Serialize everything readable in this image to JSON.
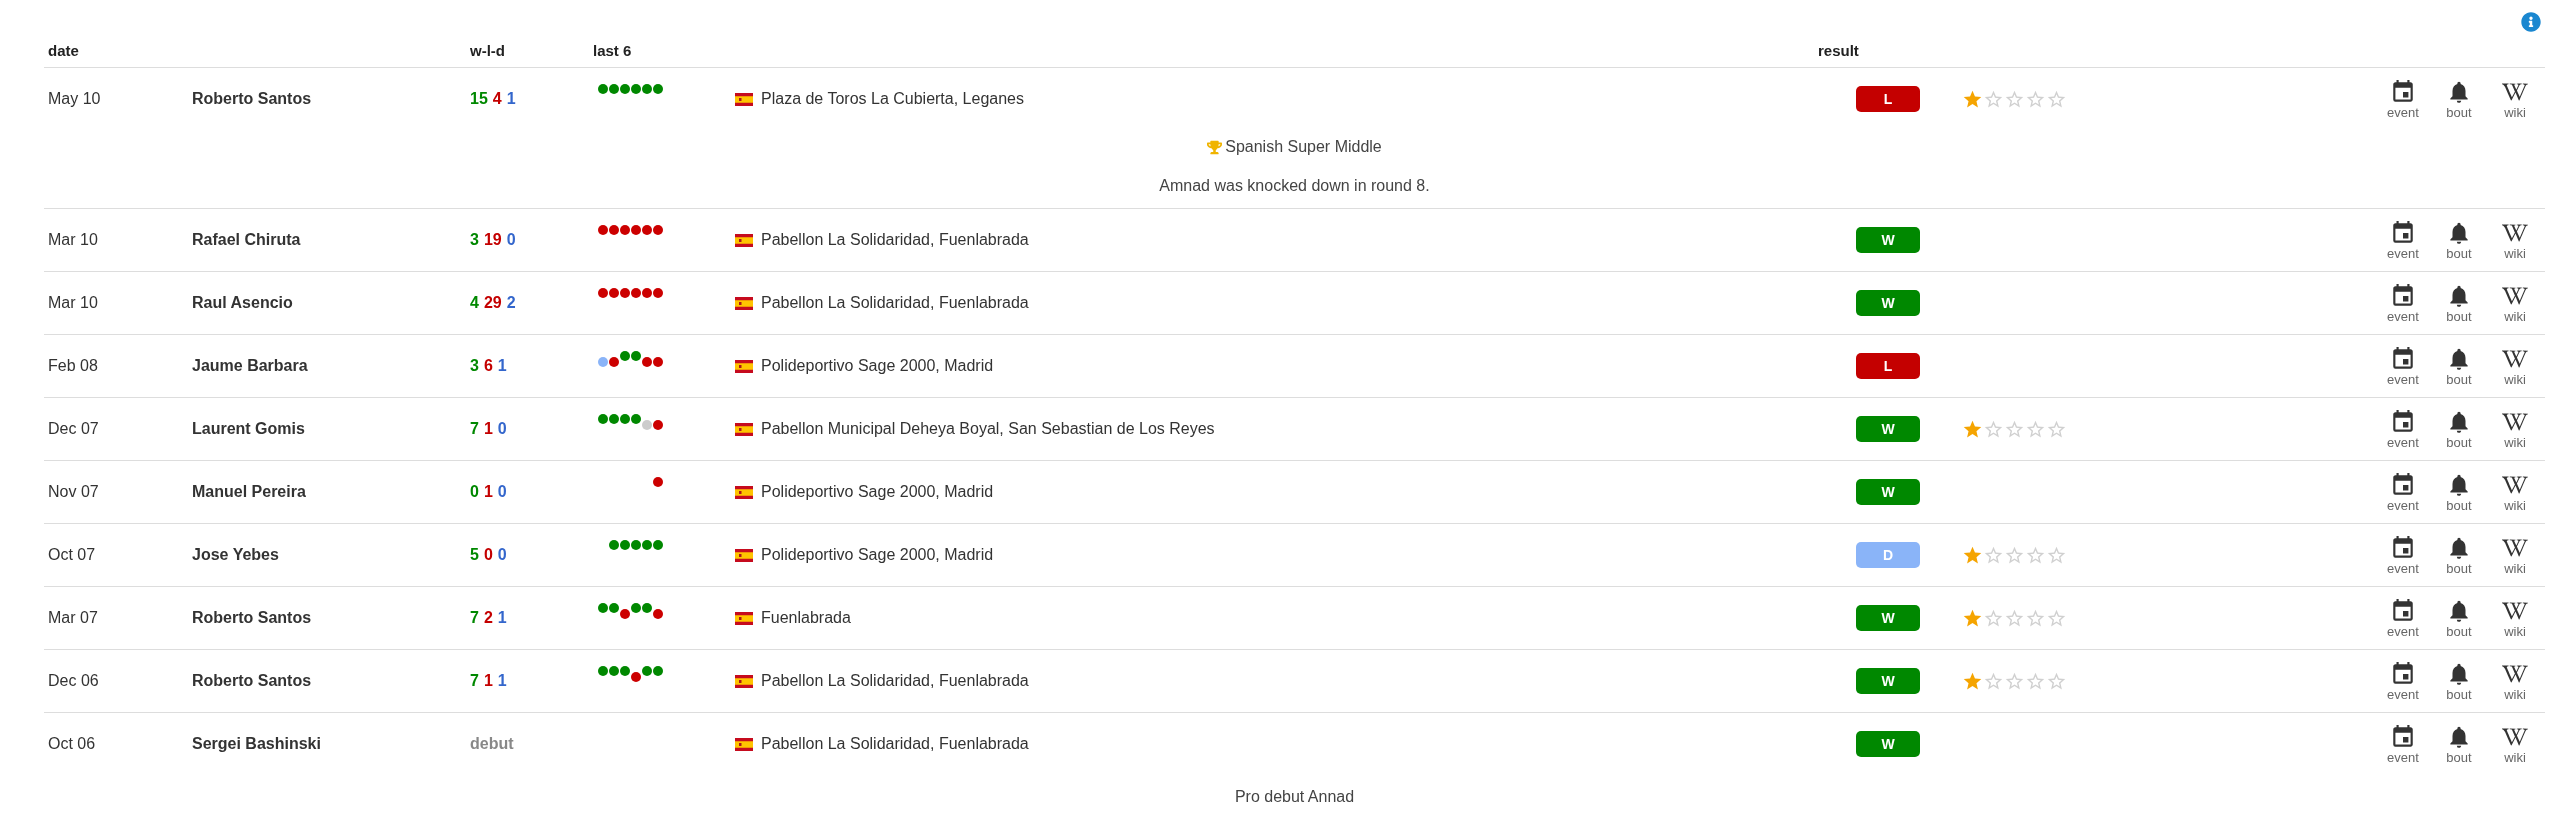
{
  "header": {
    "date": "date",
    "record": "w-l-d",
    "last_6": "last 6",
    "result": "result"
  },
  "rows": [
    {
      "date": "May 10",
      "opponent": "Roberto Santos",
      "record": {
        "kind": "counts",
        "w": "15",
        "l": "4",
        "d": "1"
      },
      "last_6": [
        {
          "kind": "win",
          "raised": true
        },
        {
          "kind": "win",
          "raised": true
        },
        {
          "kind": "win",
          "raised": true
        },
        {
          "kind": "win",
          "raised": true
        },
        {
          "kind": "win",
          "raised": true
        },
        {
          "kind": "win",
          "raised": true
        }
      ],
      "venue": "Plaza de Toros La Cubierta, Leganes",
      "result": {
        "kind": "loss",
        "label": "L"
      },
      "stars": 1,
      "links": [
        {
          "kind": "event",
          "label": "event"
        },
        {
          "kind": "bout",
          "label": "bout"
        },
        {
          "kind": "wiki",
          "label": "wiki"
        }
      ],
      "notes": [
        {
          "kind": "title",
          "text": "Spanish Super Middle"
        },
        {
          "kind": "text",
          "text": "Amnad was knocked down in round 8."
        }
      ]
    },
    {
      "date": "Mar 10",
      "opponent": "Rafael Chiruta",
      "record": {
        "kind": "counts",
        "w": "3",
        "l": "19",
        "d": "0"
      },
      "last_6": [
        {
          "kind": "loss",
          "raised": true
        },
        {
          "kind": "loss",
          "raised": true
        },
        {
          "kind": "loss",
          "raised": true
        },
        {
          "kind": "loss",
          "raised": true
        },
        {
          "kind": "loss",
          "raised": true
        },
        {
          "kind": "loss",
          "raised": true
        }
      ],
      "venue": "Pabellon La Solidaridad, Fuenlabrada",
      "result": {
        "kind": "win",
        "label": "W"
      },
      "links": [
        {
          "kind": "event",
          "label": "event"
        },
        {
          "kind": "bout",
          "label": "bout"
        },
        {
          "kind": "wiki",
          "label": "wiki"
        }
      ]
    },
    {
      "date": "Mar 10",
      "opponent": "Raul Asencio",
      "record": {
        "kind": "counts",
        "w": "4",
        "l": "29",
        "d": "2"
      },
      "last_6": [
        {
          "kind": "loss",
          "raised": true
        },
        {
          "kind": "loss",
          "raised": true
        },
        {
          "kind": "loss",
          "raised": true
        },
        {
          "kind": "loss",
          "raised": true
        },
        {
          "kind": "loss",
          "raised": true
        },
        {
          "kind": "loss",
          "raised": true
        }
      ],
      "venue": "Pabellon La Solidaridad, Fuenlabrada",
      "result": {
        "kind": "win",
        "label": "W"
      },
      "links": [
        {
          "kind": "event",
          "label": "event"
        },
        {
          "kind": "bout",
          "label": "bout"
        },
        {
          "kind": "wiki",
          "label": "wiki"
        }
      ]
    },
    {
      "date": "Feb 08",
      "opponent": "Jaume Barbara",
      "record": {
        "kind": "counts",
        "w": "3",
        "l": "6",
        "d": "1"
      },
      "last_6": [
        {
          "kind": "draw",
          "raised": false
        },
        {
          "kind": "loss",
          "raised": false
        },
        {
          "kind": "win",
          "raised": true
        },
        {
          "kind": "win",
          "raised": true
        },
        {
          "kind": "loss",
          "raised": false
        },
        {
          "kind": "loss",
          "raised": false
        }
      ],
      "venue": "Polideportivo Sage 2000, Madrid",
      "result": {
        "kind": "loss",
        "label": "L"
      },
      "links": [
        {
          "kind": "event",
          "label": "event"
        },
        {
          "kind": "bout",
          "label": "bout"
        },
        {
          "kind": "wiki",
          "label": "wiki"
        }
      ]
    },
    {
      "date": "Dec 07",
      "opponent": "Laurent Gomis",
      "record": {
        "kind": "counts",
        "w": "7",
        "l": "1",
        "d": "0"
      },
      "last_6": [
        {
          "kind": "win",
          "raised": true
        },
        {
          "kind": "win",
          "raised": true
        },
        {
          "kind": "win",
          "raised": true
        },
        {
          "kind": "win",
          "raised": true
        },
        {
          "kind": "nc",
          "raised": false
        },
        {
          "kind": "loss",
          "raised": false
        }
      ],
      "venue": "Pabellon Municipal Deheya Boyal, San Sebastian de Los Reyes",
      "result": {
        "kind": "win",
        "label": "W"
      },
      "stars": 1,
      "links": [
        {
          "kind": "event",
          "label": "event"
        },
        {
          "kind": "bout",
          "label": "bout"
        },
        {
          "kind": "wiki",
          "label": "wiki"
        }
      ]
    },
    {
      "date": "Nov 07",
      "opponent": "Manuel Pereira",
      "record": {
        "kind": "counts",
        "w": "0",
        "l": "1",
        "d": "0"
      },
      "last_6": [
        {
          "kind": "loss",
          "raised": true
        }
      ],
      "venue": "Polideportivo Sage 2000, Madrid",
      "result": {
        "kind": "win",
        "label": "W"
      },
      "links": [
        {
          "kind": "event",
          "label": "event"
        },
        {
          "kind": "bout",
          "label": "bout"
        },
        {
          "kind": "wiki",
          "label": "wiki"
        }
      ]
    },
    {
      "date": "Oct 07",
      "opponent": "Jose Yebes",
      "record": {
        "kind": "counts",
        "w": "5",
        "l": "0",
        "d": "0"
      },
      "last_6": [
        {
          "kind": "win",
          "raised": true
        },
        {
          "kind": "win",
          "raised": true
        },
        {
          "kind": "win",
          "raised": true
        },
        {
          "kind": "win",
          "raised": true
        },
        {
          "kind": "win",
          "raised": true
        }
      ],
      "venue": "Polideportivo Sage 2000, Madrid",
      "result": {
        "kind": "draw",
        "label": "D"
      },
      "stars": 1,
      "links": [
        {
          "kind": "event",
          "label": "event"
        },
        {
          "kind": "bout",
          "label": "bout"
        },
        {
          "kind": "wiki",
          "label": "wiki"
        }
      ]
    },
    {
      "date": "Mar 07",
      "opponent": "Roberto Santos",
      "record": {
        "kind": "counts",
        "w": "7",
        "l": "2",
        "d": "1"
      },
      "last_6": [
        {
          "kind": "win",
          "raised": true
        },
        {
          "kind": "win",
          "raised": true
        },
        {
          "kind": "loss",
          "raised": false
        },
        {
          "kind": "win",
          "raised": true
        },
        {
          "kind": "win",
          "raised": true
        },
        {
          "kind": "loss",
          "raised": false
        }
      ],
      "venue": "Fuenlabrada",
      "result": {
        "kind": "win",
        "label": "W"
      },
      "stars": 1,
      "links": [
        {
          "kind": "event",
          "label": "event"
        },
        {
          "kind": "bout",
          "label": "bout"
        },
        {
          "kind": "wiki",
          "label": "wiki"
        }
      ]
    },
    {
      "date": "Dec 06",
      "opponent": "Roberto Santos",
      "record": {
        "kind": "counts",
        "w": "7",
        "l": "1",
        "d": "1"
      },
      "last_6": [
        {
          "kind": "win",
          "raised": true
        },
        {
          "kind": "win",
          "raised": true
        },
        {
          "kind": "win",
          "raised": true
        },
        {
          "kind": "loss",
          "raised": false
        },
        {
          "kind": "win",
          "raised": true
        },
        {
          "kind": "win",
          "raised": true
        }
      ],
      "venue": "Pabellon La Solidaridad, Fuenlabrada",
      "result": {
        "kind": "win",
        "label": "W"
      },
      "stars": 1,
      "links": [
        {
          "kind": "event",
          "label": "event"
        },
        {
          "kind": "bout",
          "label": "bout"
        },
        {
          "kind": "wiki",
          "label": "wiki"
        }
      ]
    },
    {
      "date": "Oct 06",
      "opponent": "Sergei Bashinski",
      "record": {
        "kind": "debut",
        "text": "debut"
      },
      "last_6": [],
      "venue": "Pabellon La Solidaridad, Fuenlabrada",
      "result": {
        "kind": "win",
        "label": "W"
      },
      "links": [
        {
          "kind": "event",
          "label": "event"
        },
        {
          "kind": "bout",
          "label": "bout"
        },
        {
          "kind": "wiki",
          "label": "wiki"
        }
      ],
      "notes": [
        {
          "kind": "text",
          "text": "Pro debut Annad"
        }
      ]
    }
  ]
}
